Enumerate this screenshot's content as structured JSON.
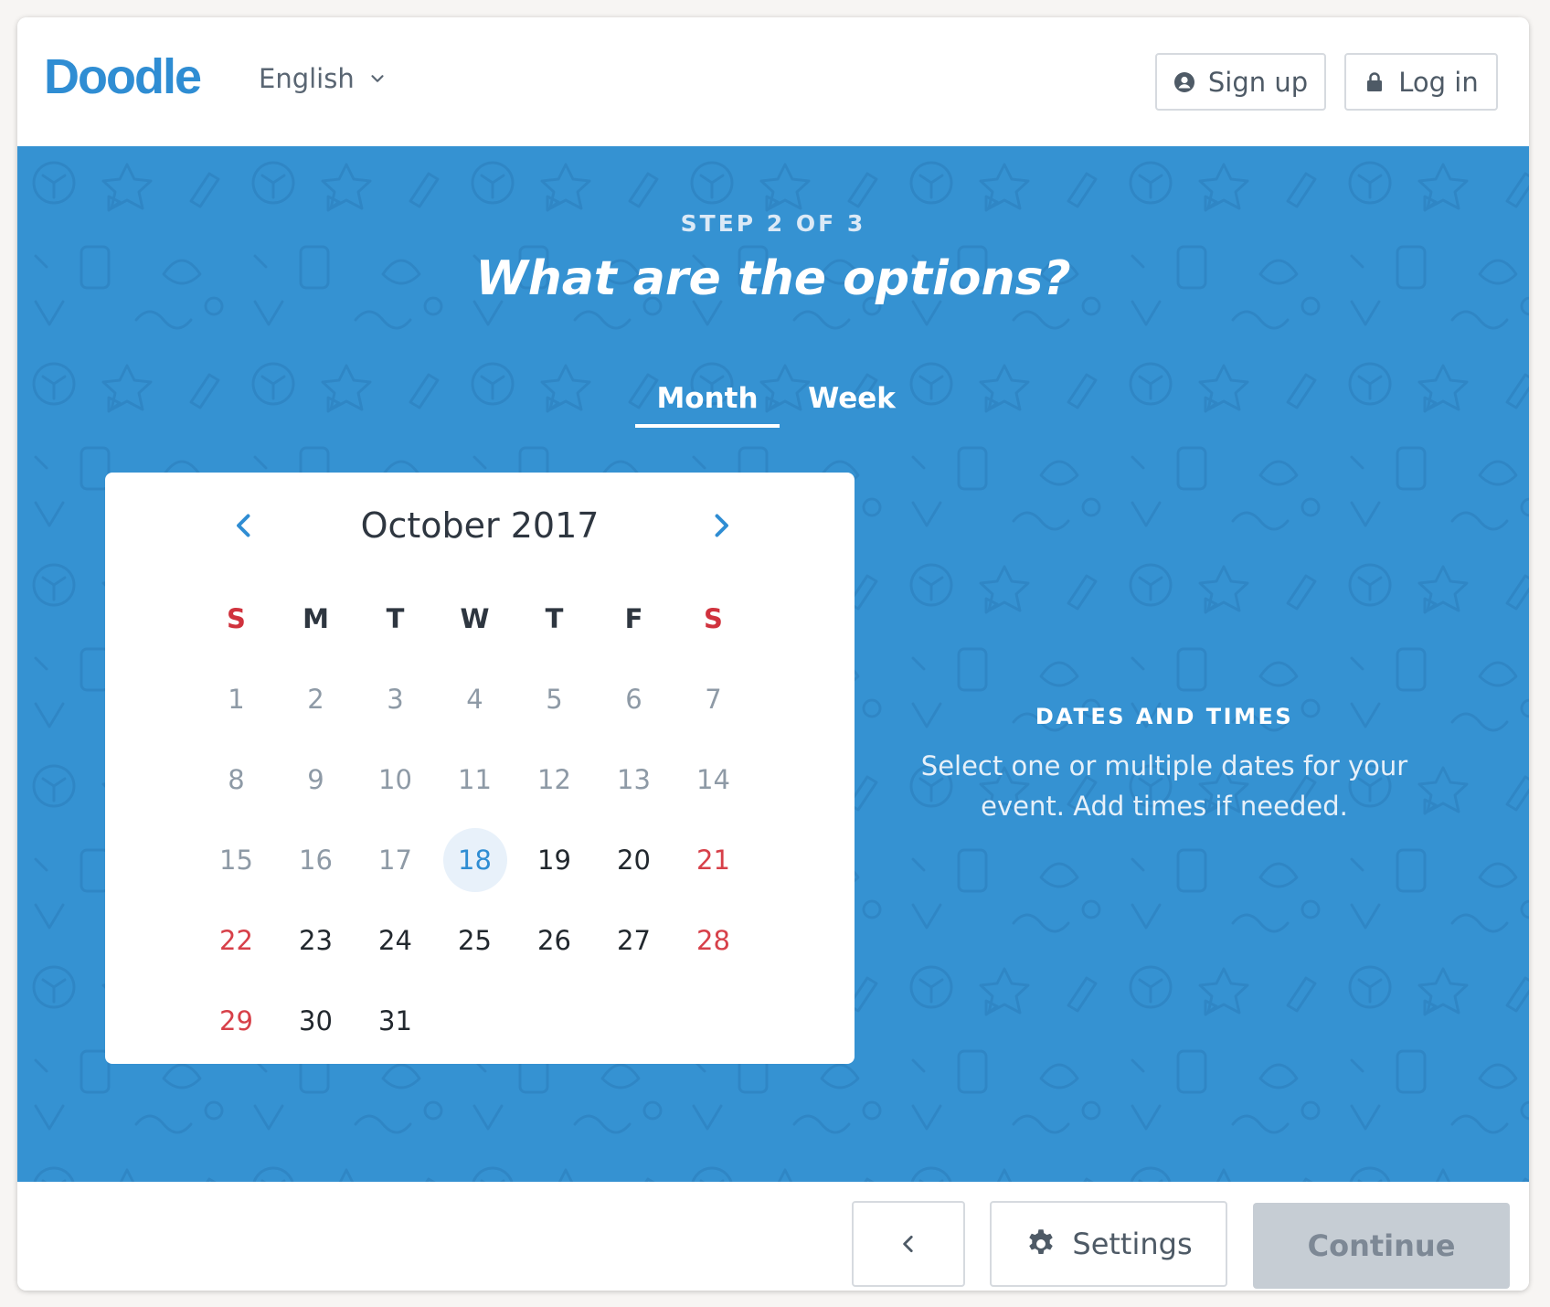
{
  "header": {
    "logo": "Doodle",
    "language": "English",
    "signup_label": "Sign up",
    "login_label": "Log in"
  },
  "hero": {
    "step": "STEP 2 OF 3",
    "title": "What are the options?",
    "tabs": [
      {
        "label": "Month",
        "active": true
      },
      {
        "label": "Week",
        "active": false
      }
    ]
  },
  "calendar": {
    "month_label": "October 2017",
    "weekdays": [
      "S",
      "M",
      "T",
      "W",
      "T",
      "F",
      "S"
    ],
    "today": 18,
    "days": [
      "1",
      "2",
      "3",
      "4",
      "5",
      "6",
      "7",
      "8",
      "9",
      "10",
      "11",
      "12",
      "13",
      "14",
      "15",
      "16",
      "17",
      "18",
      "19",
      "20",
      "21",
      "22",
      "23",
      "24",
      "25",
      "26",
      "27",
      "28",
      "29",
      "30",
      "31"
    ]
  },
  "info": {
    "title": "DATES AND TIMES",
    "text": "Select one or multiple dates for your event. Add times if needed."
  },
  "footer": {
    "settings_label": "Settings",
    "continue_label": "Continue"
  },
  "colors": {
    "brand": "#2f8dd3",
    "hero_bg": "#3592d2",
    "weekend": "#d0323d",
    "disabled": "#c6cdd4"
  }
}
